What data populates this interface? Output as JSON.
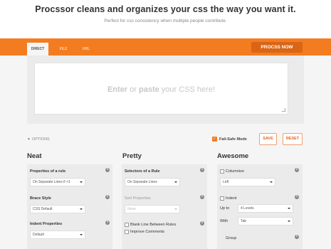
{
  "hero": {
    "title": "Procssor cleans and organizes your css the way you want it.",
    "subtitle": "Perfect for css consistency when multiple people contribute."
  },
  "tabs": [
    {
      "label": "DIRECT",
      "active": true
    },
    {
      "label": "FILE",
      "active": false
    },
    {
      "label": "URL",
      "active": false
    }
  ],
  "process_button": "PROCSS NOW",
  "editor": {
    "ph_enter": "Enter",
    "ph_or": " or ",
    "ph_paste": "paste",
    "ph_rest": " your CSS here!"
  },
  "options": {
    "toggle_label": "OPTIONS",
    "failsafe_label": "Fail-Safe Mode",
    "failsafe_checked": true,
    "save_label": "SAVE",
    "reset_label": "RESET"
  },
  "neat": {
    "title": "Neat",
    "properties_label": "Properties of a rule",
    "properties_value": "On Separate Lines if >1",
    "brace_label": "Brace Style",
    "brace_value": "CSS Default",
    "indent_label": "Indent Properties",
    "indent_value": "Default"
  },
  "pretty": {
    "title": "Pretty",
    "selectors_label": "Selectors of a Rule",
    "selectors_value": "On Separate Lines",
    "sort_label": "Sort Properties",
    "sort_value": "None",
    "blank_line_label": "Blank Line Between Rules",
    "improve_comments_label": "Improve Comments"
  },
  "awesome": {
    "title": "Awesome",
    "columnize_label": "Columnize",
    "columnize_value": "Left",
    "indent_label": "Indent",
    "upto_label": "Up to",
    "upto_value": "4 Levels",
    "with_label": "With",
    "with_value": "Tab",
    "group_label": "Group"
  },
  "icons": {
    "info": "i",
    "check": "✓"
  },
  "colors": {
    "accent": "#f47c20",
    "button_dark": "#d96515",
    "panel_bg": "#ebebeb"
  }
}
